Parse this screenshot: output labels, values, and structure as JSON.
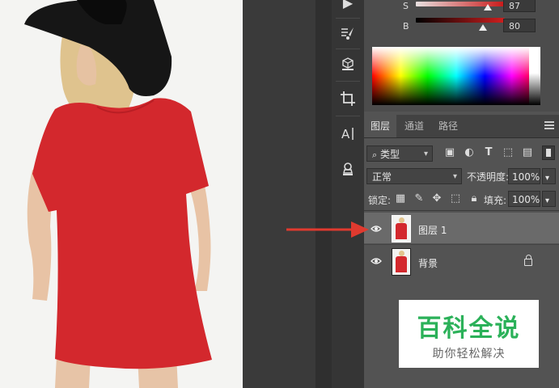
{
  "color_panel": {
    "channels": [
      {
        "label": "S",
        "value": "87"
      },
      {
        "label": "B",
        "value": "80"
      }
    ]
  },
  "layers_panel": {
    "tabs": [
      "图层",
      "通道",
      "路径"
    ],
    "filter_kind": "类型",
    "blend_mode": "正常",
    "opacity_label": "不透明度:",
    "opacity_value": "100%",
    "lock_label": "锁定:",
    "fill_label": "填充:",
    "fill_value": "100%",
    "layers": [
      {
        "name": "图层 1",
        "selected": true,
        "locked": false
      },
      {
        "name": "背景",
        "selected": false,
        "locked": true
      }
    ]
  },
  "watermark": {
    "title": "百科全说",
    "subtitle": "助你轻松解决"
  },
  "colors": {
    "arrow": "#e03a2f",
    "shirt": "#d3282d",
    "panel_bg": "#535353",
    "selected_layer": "#6a6a6a",
    "watermark_green": "#2bb159"
  }
}
